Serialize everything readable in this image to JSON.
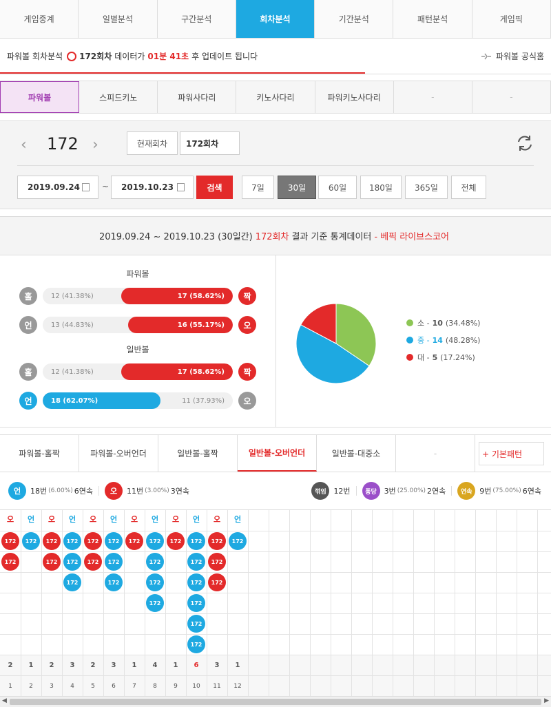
{
  "nav": {
    "tabs": [
      "게임중계",
      "일별분석",
      "구간분석",
      "회차분석",
      "기간분석",
      "패턴분석",
      "게임픽"
    ],
    "active": 3
  },
  "notice": {
    "prefix": "파워볼 회차분석",
    "round": "172회차",
    "mid": "데이터가",
    "time": "01분 41초",
    "suffix": "후 업데이트 됩니다",
    "official": "파워볼 공식홈"
  },
  "games": {
    "tabs": [
      "파워볼",
      "스피드키노",
      "파워사다리",
      "키노사다리",
      "파워키노사다리",
      "-",
      "-"
    ],
    "active": 0
  },
  "control": {
    "round": "172",
    "current_label": "현재회차",
    "current_value": "172회차",
    "date_from": "2019.09.24",
    "tilde": "~",
    "date_to": "2019.10.23",
    "search": "검색",
    "periods": [
      "7일",
      "30일",
      "60일",
      "180일",
      "365일",
      "전체"
    ],
    "active_period": 1
  },
  "summary": {
    "range": "2019.09.24 ~ 2019.10.23 (30일간)",
    "round": "172회차",
    "text": "결과 기준 통계데이터",
    "source": "- 베픽 라이브스코어"
  },
  "stats": {
    "powerball_label": "파워볼",
    "normal_label": "일반볼",
    "rows": [
      {
        "left": "홀",
        "right": "짝",
        "left_text": "12 (41.38%)",
        "right_text": "17 (58.62%)",
        "left_pct": 41.38,
        "winner": "right",
        "left_color": "gray",
        "right_color": "red"
      },
      {
        "left": "언",
        "right": "오",
        "left_text": "13 (44.83%)",
        "right_text": "16 (55.17%)",
        "left_pct": 44.83,
        "winner": "right",
        "left_color": "gray",
        "right_color": "red"
      },
      {
        "left": "홀",
        "right": "짝",
        "left_text": "12 (41.38%)",
        "right_text": "17 (58.62%)",
        "left_pct": 41.38,
        "winner": "right",
        "left_color": "gray",
        "right_color": "red"
      },
      {
        "left": "언",
        "right": "오",
        "left_text": "18 (62.07%)",
        "right_text": "11 (37.93%)",
        "left_pct": 62.07,
        "winner": "left",
        "left_color": "blue",
        "right_color": "gray"
      }
    ],
    "pie": [
      {
        "label": "소",
        "count": "10",
        "pct": "(34.48%)",
        "value": 34.48,
        "color": "#8dc655"
      },
      {
        "label": "중",
        "count": "14",
        "pct": "(48.28%)",
        "value": 48.28,
        "color": "#1ea9e1"
      },
      {
        "label": "대",
        "count": "5",
        "pct": "(17.24%)",
        "value": 17.24,
        "color": "#e32a2a"
      }
    ]
  },
  "pattern": {
    "tabs": [
      "파워볼-홀짝",
      "파워볼-오버언더",
      "일반볼-홀짝",
      "일반볼-오버언더",
      "일반볼-대중소",
      "-"
    ],
    "active": 3,
    "basic": "+ 기본패턴",
    "under": {
      "icon": "언",
      "count": "18번",
      "pct": "(6.00%)",
      "streak": "6연속"
    },
    "over": {
      "icon": "오",
      "count": "11번",
      "pct": "(3.00%)",
      "streak": "3연속"
    },
    "break": {
      "icon": "꺾임",
      "count": "12번"
    },
    "pong": {
      "icon": "퐁당",
      "count": "3번",
      "pct": "(25.00%)",
      "streak": "2연속"
    },
    "streak": {
      "icon": "연속",
      "count": "9번",
      "pct": "(75.00%)",
      "streak": "6연속"
    },
    "ball_label": "172",
    "columns": [
      {
        "h": "오",
        "n": 2,
        "idx": "1"
      },
      {
        "h": "언",
        "n": 1,
        "idx": "2"
      },
      {
        "h": "오",
        "n": 2,
        "idx": "3"
      },
      {
        "h": "언",
        "n": 3,
        "idx": "4"
      },
      {
        "h": "오",
        "n": 2,
        "idx": "5"
      },
      {
        "h": "언",
        "n": 3,
        "idx": "6"
      },
      {
        "h": "오",
        "n": 1,
        "idx": "7"
      },
      {
        "h": "언",
        "n": 4,
        "idx": "8"
      },
      {
        "h": "오",
        "n": 1,
        "idx": "9"
      },
      {
        "h": "언",
        "n": 6,
        "idx": "10"
      },
      {
        "h": "오",
        "n": 3,
        "idx": "11"
      },
      {
        "h": "언",
        "n": 1,
        "idx": "12"
      }
    ],
    "colors": {
      "over": "#e32a2a",
      "under": "#1ea9e1"
    }
  }
}
